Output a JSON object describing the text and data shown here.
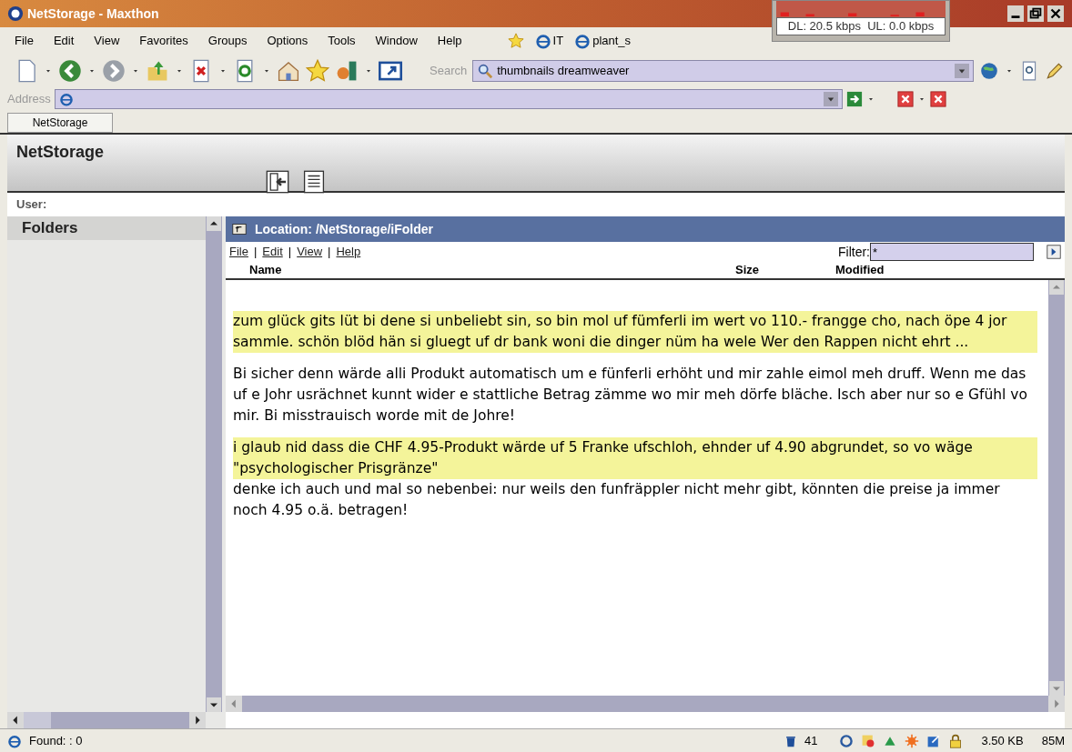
{
  "window": {
    "title": "NetStorage - Maxthon"
  },
  "net_meter": {
    "reading": "DL: 20.5 kbps  UL: 0.0 kbps"
  },
  "menu_bar": [
    "File",
    "Edit",
    "View",
    "Favorites",
    "Groups",
    "Options",
    "Tools",
    "Window",
    "Help"
  ],
  "favorites": [
    "IT",
    "plant_s"
  ],
  "search": {
    "label": "Search",
    "value": "thumbnails dreamweaver"
  },
  "address": {
    "label": "Address"
  },
  "tabs": [
    {
      "label": "NetStorage",
      "selected": true
    }
  ],
  "page": {
    "title": "NetStorage",
    "user_label": "User:",
    "folders": {
      "title": "Folders"
    },
    "location": "Location: /NetStorage/iFolder",
    "links": [
      {
        "label": "File"
      },
      {
        "prefix": "|",
        "label": "Edit"
      },
      {
        "prefix": "|",
        "label": "View"
      },
      {
        "prefix": "|",
        "label": "Help"
      }
    ],
    "filter": {
      "label": "Filter:",
      "value": "*"
    },
    "columns": [
      "Name",
      "Size",
      "Modified"
    ],
    "paragraphs": [
      {
        "text": "zum glück gits lüt bi dene si unbeliebt sin, so bin mol uf fümferli im wert vo 110.- frangge cho, nach öpe 4 jor sammle. schön blöd hän si gluegt uf dr bank woni die dinger nüm ha wele Wer den Rappen nicht ehrt ...",
        "highlighted": true
      },
      {
        "text": "Bi sicher denn wärde alli Produkt automatisch um e fünferli erhöht und mir zahle eimol meh druff. Wenn me das uf e Johr usrächnet kunnt wider e stattliche Betrag zämme wo mir meh dörfe bläche. Isch aber nur so e Gfühl vo mir. Bi misstrauisch worde mit de Johre!",
        "highlighted": false
      },
      {
        "text": "i glaub nid dass die CHF 4.95-Produkt wärde uf 5 Franke ufschloh, ehnder uf 4.90 abgrundet, so vo wäge \"psychologischer Prisgränze\"",
        "highlighted": true
      },
      {
        "text": "denke ich auch und mal so nebenbei: nur weils den funfräppler nicht mehr gibt, könnten die preise ja immer noch 4.95 o.ä. betragen!",
        "highlighted": false
      }
    ]
  },
  "status_bar": {
    "found": "Found: : 0",
    "trash_count": "41",
    "size": "3.50 KB",
    "memory": "85M"
  }
}
